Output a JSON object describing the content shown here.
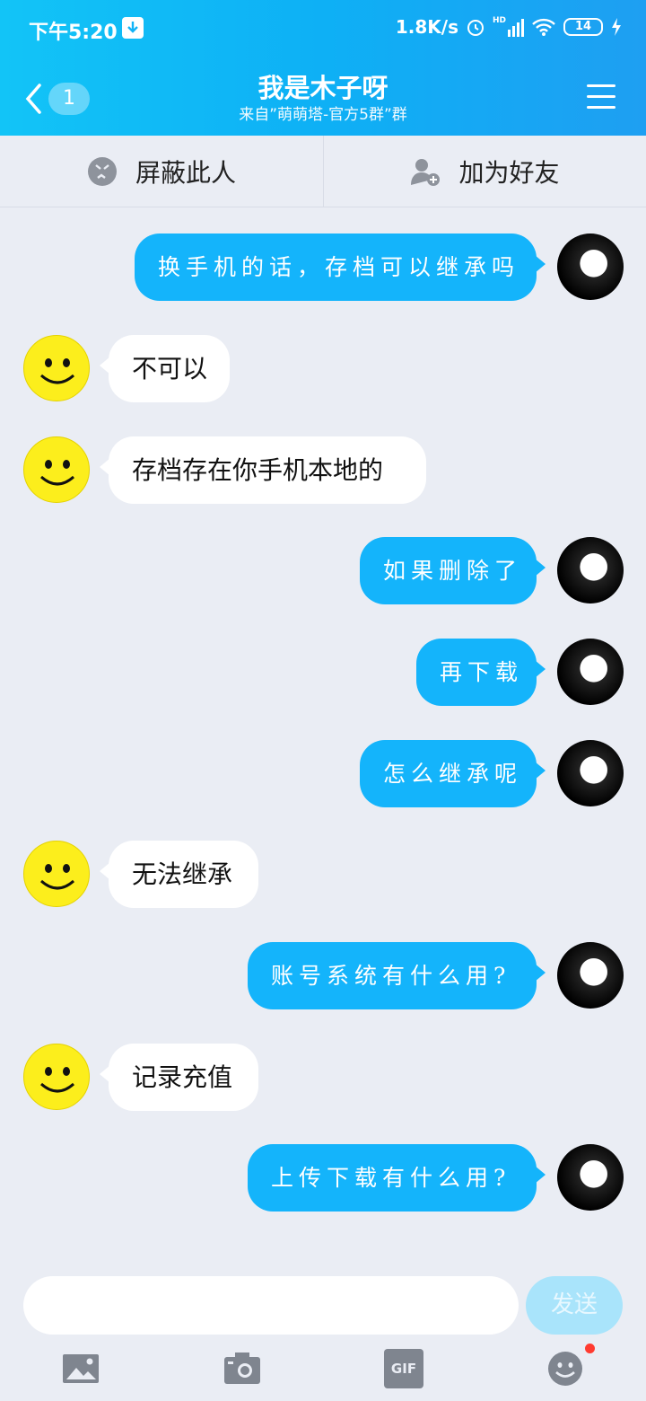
{
  "status_bar": {
    "time": "下午5:20",
    "net_speed": "1.8K/s",
    "signal": "HD",
    "battery": "14"
  },
  "header": {
    "unread_count": "1",
    "title": "我是木子呀",
    "subtitle": "来自”萌萌塔-官方5群”群"
  },
  "actions": {
    "block_label": "屏蔽此人",
    "add_friend_label": "加为好友"
  },
  "messages": [
    {
      "side": "right",
      "text": "换手机的话，存档可以继承吗"
    },
    {
      "side": "left",
      "text": "不可以"
    },
    {
      "side": "left",
      "text": "存档存在你手机本地的"
    },
    {
      "side": "right",
      "text": "如果删除了"
    },
    {
      "side": "right",
      "text": "再下载"
    },
    {
      "side": "right",
      "text": "怎么继承呢"
    },
    {
      "side": "left",
      "text": "无法继承"
    },
    {
      "side": "right",
      "text": "账号系统有什么用?"
    },
    {
      "side": "left",
      "text": "记录充值"
    },
    {
      "side": "right",
      "text": "上传下载有什么用?"
    }
  ],
  "composer": {
    "input_value": "",
    "send_label": "发送"
  },
  "toolbar": {
    "gif_label": "GIF"
  },
  "colors": {
    "header_start": "#12c4f7",
    "header_end": "#1e9ff2",
    "outgoing_bubble": "#14b4fb",
    "incoming_bubble": "#ffffff",
    "background": "#eaedf4",
    "send_disabled": "#a9e4fb"
  }
}
